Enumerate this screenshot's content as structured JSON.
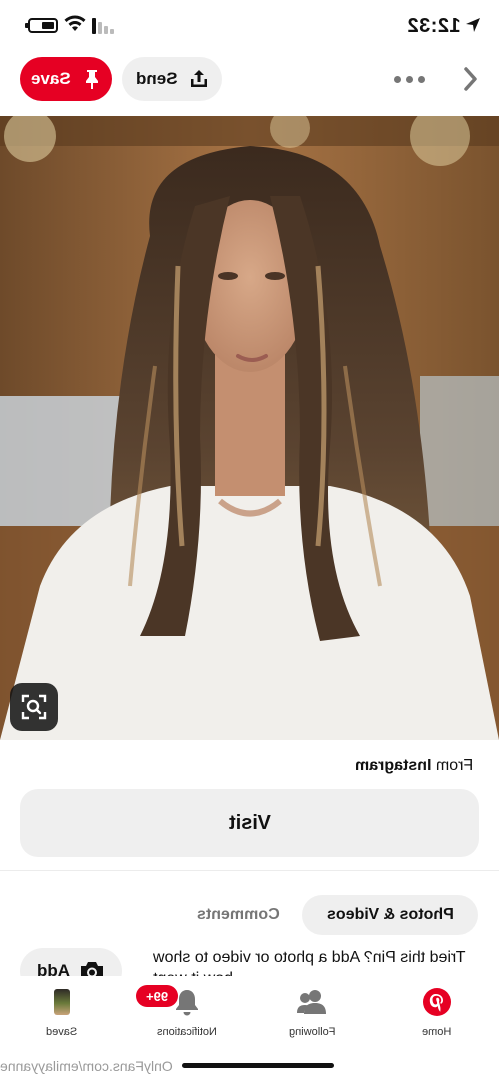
{
  "status_bar": {
    "time": "12:32"
  },
  "top_bar": {
    "save_label": "Save",
    "send_label": "Send"
  },
  "pin": {
    "source_prefix": "From",
    "source_name": "Instagram",
    "visit_label": "Visit"
  },
  "tabs": {
    "photos_label": "Photos & Videos",
    "comments_label": "Comments"
  },
  "tried": {
    "text": "Tried this Pin? Add a photo or video to show how it went",
    "add_label": "Add"
  },
  "nav": {
    "home_label": "Home",
    "following_label": "Following",
    "notifications_label": "Notifications",
    "notifications_badge": "99+",
    "saved_label": "Saved"
  },
  "watermark": "OnlyFans.com/emilayyanne",
  "colors": {
    "accent": "#e60023",
    "button_bg": "#efefef",
    "text": "#111111",
    "muted": "#767676"
  }
}
